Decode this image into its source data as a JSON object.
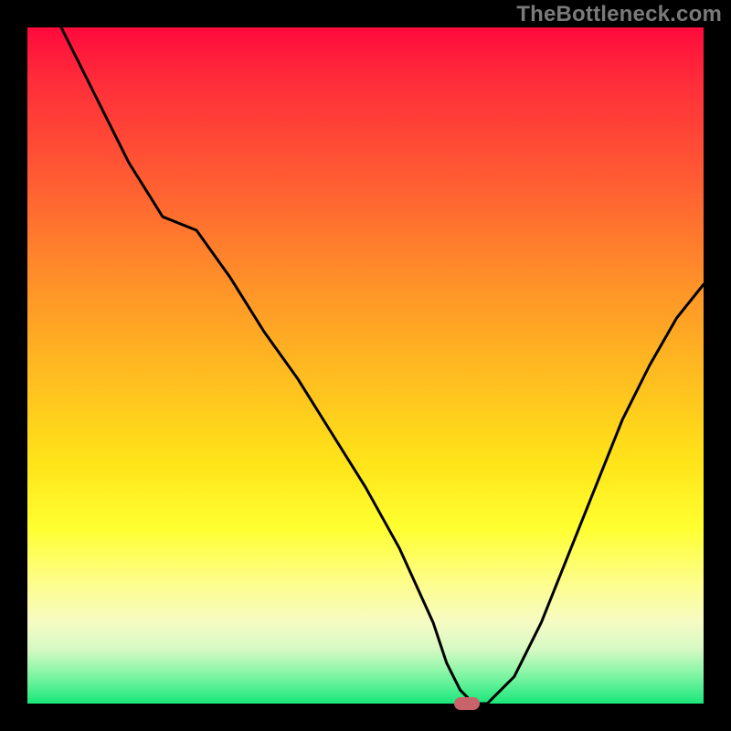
{
  "watermark": "TheBottleneck.com",
  "chart_data": {
    "type": "line",
    "title": "",
    "xlabel": "",
    "ylabel": "",
    "xlim": [
      0,
      100
    ],
    "ylim": [
      0,
      100
    ],
    "grid": false,
    "legend": false,
    "background_gradient": {
      "top": "#ff0a3c",
      "mid": "#ffe319",
      "bottom": "#19e67a"
    },
    "series": [
      {
        "name": "bottleneck-curve",
        "color": "#000000",
        "x": [
          5,
          10,
          15,
          20,
          25,
          30,
          35,
          40,
          45,
          50,
          55,
          60,
          62,
          64,
          66,
          68,
          72,
          76,
          80,
          84,
          88,
          92,
          96,
          100
        ],
        "y": [
          100,
          90,
          80,
          72,
          70,
          63,
          55,
          48,
          40,
          32,
          23,
          12,
          6,
          2,
          0,
          0,
          4,
          12,
          22,
          32,
          42,
          50,
          57,
          62
        ]
      }
    ],
    "marker": {
      "name": "optimal-zone",
      "x": 65,
      "y": 0,
      "color": "#c9636a"
    }
  }
}
